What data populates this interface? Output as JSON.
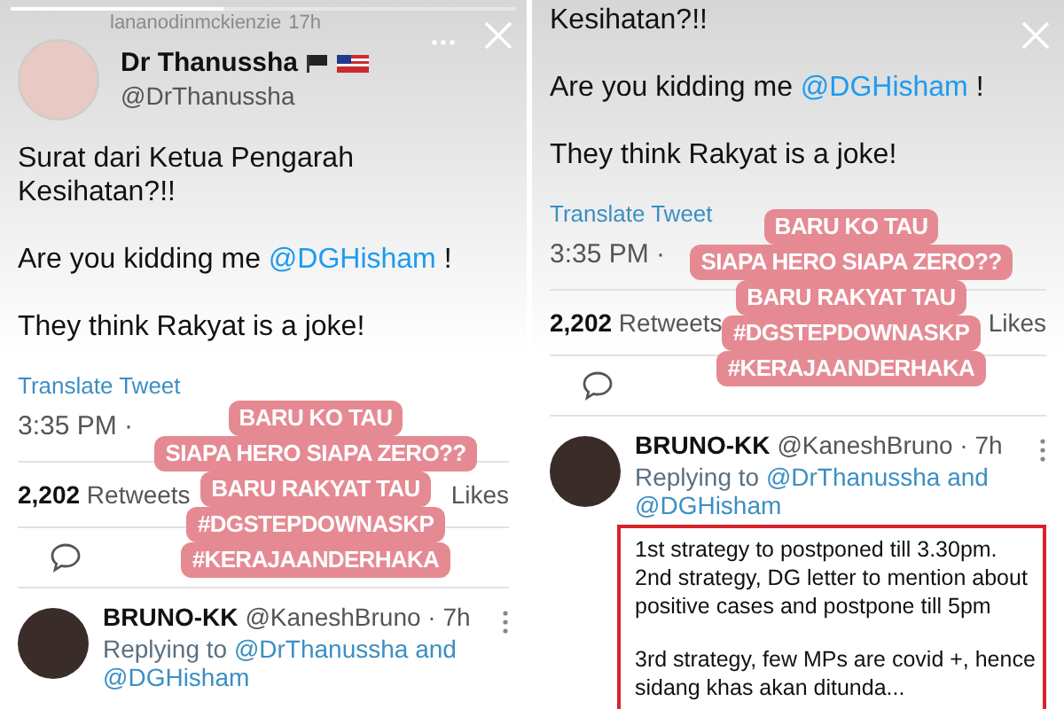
{
  "panels": [
    {
      "story_header": {
        "username": "lananodinmckienzie",
        "time": "17h",
        "progress": {
          "level": 0.42
        }
      },
      "tweet": {
        "author": "Dr Thanussha",
        "handle": "@DrThanussha",
        "paragraphs": [
          [
            {
              "text": "Surat dari Ketua Pengarah Kesihatan?!!",
              "kind": "plain"
            }
          ],
          [
            {
              "text": "Are you kidding me ",
              "kind": "plain"
            },
            {
              "text": "@DGHisham",
              "kind": "mention"
            },
            {
              "text": " !",
              "kind": "plain"
            }
          ],
          [
            {
              "text": "They think Rakyat is a joke!",
              "kind": "plain"
            }
          ]
        ],
        "translate": "Translate Tweet",
        "timestamp": "3:35 PM ·",
        "retweet_count": "2,202",
        "retweet_label": "Retweets",
        "likes_label": "Likes"
      },
      "sticker": [
        "BARU KO TAU",
        "SIAPA HERO SIAPA ZERO??",
        "BARU RAKYAT TAU",
        "#DGSTEPDOWNASKP",
        "#KERAJAANDERHAKA"
      ],
      "reply": {
        "author": "BRUNO-KK",
        "handle_time": "@KaneshBruno · 7h",
        "replying_prefix": "Replying to",
        "replying_to": "@DrThanussha and @DGHisham"
      }
    },
    {
      "tweet": {
        "paragraphs": [
          [
            {
              "text": "Kesihatan?!!",
              "kind": "plain"
            }
          ],
          [
            {
              "text": "Are you kidding me ",
              "kind": "plain"
            },
            {
              "text": "@DGHisham",
              "kind": "mention"
            },
            {
              "text": " !",
              "kind": "plain"
            }
          ],
          [
            {
              "text": "They think Rakyat is a joke!",
              "kind": "plain"
            }
          ]
        ],
        "translate": "Translate Tweet",
        "timestamp": "3:35 PM ·",
        "retweet_count": "2,202",
        "retweet_label": "Retweets",
        "likes_label": "Likes"
      },
      "sticker": [
        "BARU KO TAU",
        "SIAPA HERO SIAPA ZERO??",
        "BARU RAKYAT TAU",
        "#DGSTEPDOWNASKP",
        "#KERAJAANDERHAKA"
      ],
      "reply": {
        "author": "BRUNO-KK",
        "handle_time": "@KaneshBruno · 7h",
        "replying_prefix": "Replying to",
        "replying_to": "@DrThanussha and @DGHisham",
        "highlighted": true,
        "text": [
          [
            "1st strategy to postponed till 3.30pm.",
            "2nd strategy, DG letter to mention about",
            "positive cases and postpone till 5pm"
          ],
          [
            "3rd strategy, few MPs are covid +, hence",
            "sidang khas akan ditunda..."
          ]
        ]
      }
    }
  ]
}
